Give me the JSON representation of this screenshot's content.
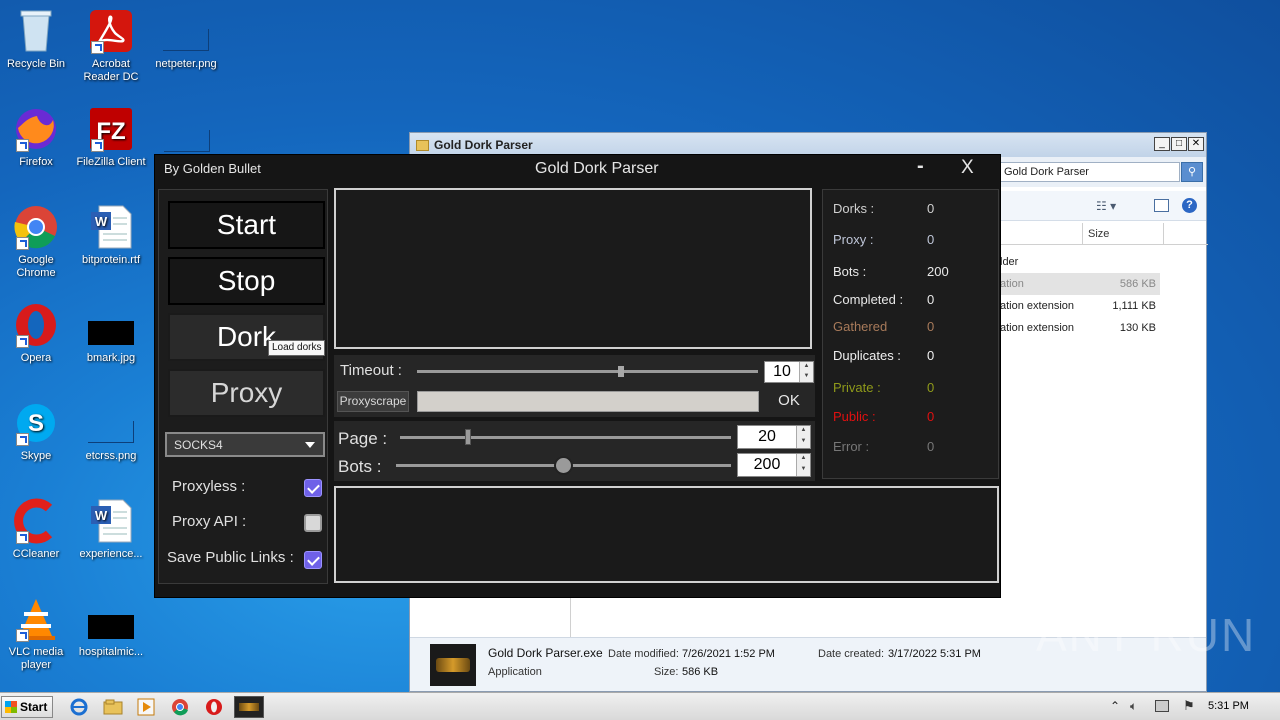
{
  "desktop": {
    "icons": [
      {
        "label": "Recycle Bin"
      },
      {
        "label": "Acrobat Reader DC"
      },
      {
        "label": "netpeter.png"
      },
      {
        "label": "Firefox"
      },
      {
        "label": "FileZilla Client"
      },
      {
        "label": "Google Chrome"
      },
      {
        "label": "bitprotein.rtf"
      },
      {
        "label": "Opera"
      },
      {
        "label": "bmark.jpg"
      },
      {
        "label": "Skype"
      },
      {
        "label": "etcrss.png"
      },
      {
        "label": "CCleaner"
      },
      {
        "label": "experience..."
      },
      {
        "label": "VLC media player"
      },
      {
        "label": "hospitalmic..."
      }
    ]
  },
  "explorer": {
    "title": "Gold Dork Parser",
    "search_value": "Gold Dork Parser",
    "col_size": "Size",
    "rows": [
      {
        "type": "lder",
        "size": ""
      },
      {
        "type": "ation",
        "size": "586 KB"
      },
      {
        "type": "ation extension",
        "size": "1,111 KB"
      },
      {
        "type": "ation extension",
        "size": "130 KB"
      }
    ],
    "details": {
      "name": "Gold Dork Parser.exe",
      "kind": "Application",
      "modified_label": "Date modified:",
      "modified": "7/26/2021 1:52 PM",
      "size_label": "Size:",
      "size": "586 KB",
      "created_label": "Date created:",
      "created": "3/17/2022 5:31 PM"
    }
  },
  "app": {
    "author": "By Golden Bullet",
    "title": "Gold Dork Parser",
    "minimize": "-",
    "close": "X",
    "buttons": {
      "start": "Start",
      "stop": "Stop",
      "dork": "Dork",
      "proxy": "Proxy"
    },
    "tooltip": "Load dorks",
    "proxy_type": "SOCKS4",
    "options": [
      {
        "label": "Proxyless :",
        "checked": true
      },
      {
        "label": "Proxy API :",
        "checked": false
      },
      {
        "label": "Save Public Links :",
        "checked": true
      }
    ],
    "timeout": {
      "label": "Timeout :",
      "value": "10",
      "level": 0.6
    },
    "proxyscrape": {
      "label": "Proxyscrape",
      "ok": "OK"
    },
    "page": {
      "label": "Page :",
      "value": "20",
      "level": 0.2
    },
    "bots": {
      "label": "Bots :",
      "value": "200",
      "level": 0.5
    },
    "stats": [
      {
        "label": "Dorks :",
        "value": "0",
        "color": "#d0d0d0"
      },
      {
        "label": "Proxy :",
        "value": "0",
        "color": "#bfc6d8"
      },
      {
        "label": "Bots :",
        "value": "200",
        "color": "#e8e8e8"
      },
      {
        "label": "Completed :",
        "value": "0",
        "color": "#e8e8e8"
      },
      {
        "label": "Gathered",
        "value": "0",
        "color": "#a87a5a"
      },
      {
        "label": "Duplicates :",
        "value": "0",
        "color": "#f0f0f0"
      },
      {
        "label": "Private :",
        "value": "0",
        "color": "#8f9a1a"
      },
      {
        "label": "Public :",
        "value": "0",
        "color": "#e01010"
      },
      {
        "label": "Error :",
        "value": "0",
        "color": "#777777"
      }
    ]
  },
  "taskbar": {
    "start": "Start",
    "clock": "5:31 PM"
  },
  "watermark": "ANY RUN"
}
